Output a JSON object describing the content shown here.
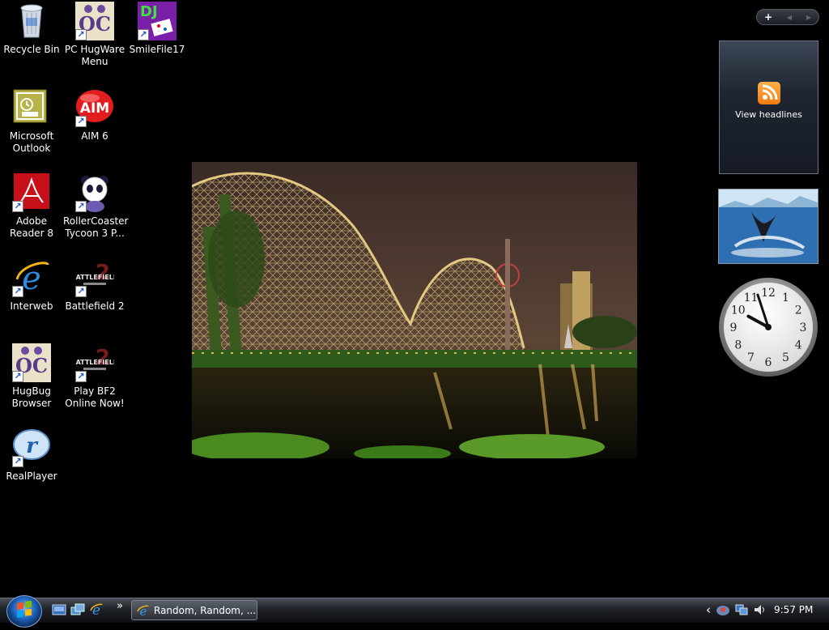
{
  "desktop": {
    "icons": [
      {
        "label": "Recycle Bin",
        "icon": "recycle-bin-icon"
      },
      {
        "label": "PC HugWare Menu",
        "icon": "hugware-icon"
      },
      {
        "label": "SmileFile17",
        "icon": "smilefile-icon"
      },
      {
        "label": "Microsoft Outlook",
        "icon": "outlook-icon"
      },
      {
        "label": "AIM 6",
        "icon": "aim-icon"
      },
      {
        "label": "Adobe Reader 8",
        "icon": "adobe-reader-icon"
      },
      {
        "label": "RollerCoaster Tycoon 3 P...",
        "icon": "panda-icon"
      },
      {
        "label": "Interweb",
        "icon": "internet-explorer-icon"
      },
      {
        "label": "Battlefield 2",
        "icon": "battlefield-icon"
      },
      {
        "label": "HugBug Browser",
        "icon": "hugbug-icon"
      },
      {
        "label": "Play BF2 Online Now!",
        "icon": "battlefield-icon"
      },
      {
        "label": "RealPlayer",
        "icon": "realplayer-icon"
      }
    ],
    "icon_texts": {
      "hugware": "OC",
      "smilefile": "DJ",
      "aim": "AIM",
      "battlefield": "BATTLEFIELD",
      "battlefield_num": "2",
      "realplayer": "r"
    }
  },
  "sidebar": {
    "controls": {
      "add": "+",
      "prev": "◀",
      "next": "▶"
    },
    "feed_gadget": {
      "label": "View headlines"
    },
    "clock": {
      "numbers": [
        "12",
        "1",
        "2",
        "3",
        "4",
        "5",
        "6",
        "7",
        "8",
        "9",
        "10",
        "11"
      ],
      "hour": 9,
      "minute": 57
    }
  },
  "taskbar": {
    "start_icon": "windows-logo-icon",
    "quick_launch_overflow": "»",
    "task_button": {
      "label": "Random, Random, ..."
    },
    "tray": {
      "chevron": "‹",
      "time": "9:57 PM"
    }
  },
  "colors": {
    "desktop": "#000000",
    "taskbar": "#1e2126",
    "accent": "#1d5fb6"
  }
}
